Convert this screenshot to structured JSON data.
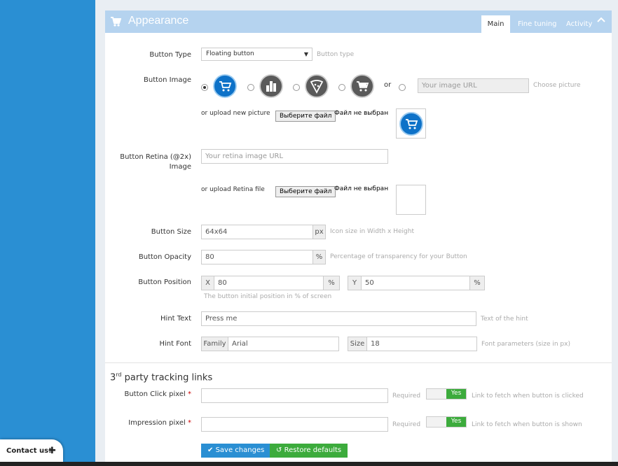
{
  "panel": {
    "title": "Appearance",
    "tabs": [
      {
        "label": "Main",
        "active": true
      },
      {
        "label": "Fine tuning",
        "active": false
      },
      {
        "label": "Activity",
        "active": false
      }
    ]
  },
  "fields": {
    "button_type": {
      "label": "Button Type",
      "value": "Floating button",
      "help": "Button type"
    },
    "button_image": {
      "label": "Button Image",
      "or": "or",
      "url_placeholder": "Your image URL",
      "choose": "Choose picture",
      "upload_label": "or upload new picture",
      "file_button": "Выберите файл",
      "file_status": "Файл не выбран"
    },
    "retina": {
      "label": "Button Retina (@2x) Image",
      "placeholder": "Your retina image URL",
      "upload_label": "or upload Retina file",
      "file_button": "Выберите файл",
      "file_status": "Файл не выбран"
    },
    "size": {
      "label": "Button Size",
      "value": "64x64",
      "unit": "px",
      "help": "Icon size in Width x Height"
    },
    "opacity": {
      "label": "Button Opacity",
      "value": "80",
      "unit": "%",
      "help": "Percentage of transparency for your Button"
    },
    "position": {
      "label": "Button Position",
      "x_label": "X",
      "x_value": "80",
      "x_unit": "%",
      "y_label": "Y",
      "y_value": "50",
      "y_unit": "%",
      "help": "The button initial position in % of screen"
    },
    "hint_text": {
      "label": "Hint Text",
      "value": "Press me",
      "help": "Text of the hint"
    },
    "hint_font": {
      "label": "Hint Font",
      "family_label": "Family",
      "family_value": "Arial",
      "size_label": "Size",
      "size_value": "18",
      "help": "Font parameters (size in px)"
    }
  },
  "tracking": {
    "title_prefix": "3",
    "title_sup": "rd",
    "title_suffix": " party tracking links",
    "click": {
      "label": "Button Click pixel",
      "required": "Required",
      "toggle": "Yes",
      "help": "Link to fetch when button is clicked"
    },
    "impression": {
      "label": "Impression pixel",
      "required": "Required",
      "toggle": "Yes",
      "help": "Link to fetch when button is shown"
    },
    "asterisk": "*"
  },
  "actions": {
    "save": "Save changes",
    "restore": "Restore defaults"
  },
  "contact": {
    "label": "Contact us!",
    "plus": "✚"
  },
  "colors": {
    "sidebar": "#2a8fd3",
    "header": "#b5d3ef",
    "primary": "#2a8fd3",
    "success": "#3cab3c",
    "icon_dark": "#5a5a5a"
  }
}
